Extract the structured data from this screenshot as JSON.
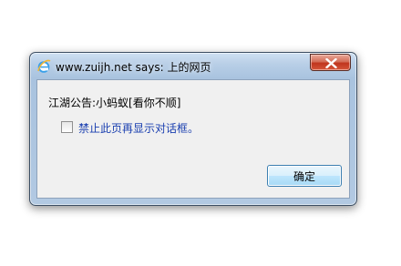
{
  "dialog": {
    "title": "www.zuijh.net says: 上的网页",
    "title_icon": "ie-icon",
    "close_icon": "close-icon",
    "message": "江湖公告:小蚂蚁[看你不顺]",
    "checkbox": {
      "label": "禁止此页再显示对话框。",
      "checked": false
    },
    "ok_label": "确定"
  },
  "colors": {
    "frame": "#b2c9e2",
    "close_button": "#c0351d",
    "checkbox_label": "#1a3fb0",
    "ok_button_border": "#3c7fb1"
  }
}
